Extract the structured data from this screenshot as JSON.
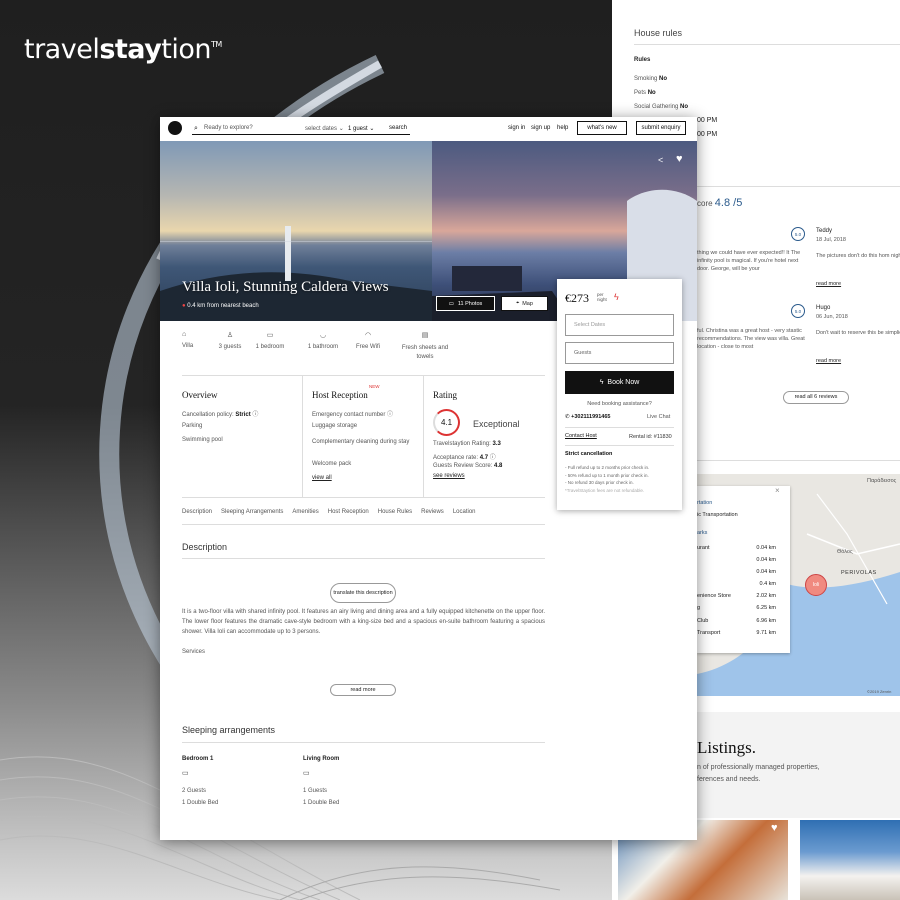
{
  "brand": {
    "prefix": "travel",
    "bold": "stay",
    "suffix": "tion",
    "tm": "TM"
  },
  "nav": {
    "search_placeholder": "Ready to explore?",
    "select_dates": "select dates",
    "guests": "1 guest",
    "search": "search",
    "sign_in": "sign in",
    "sign_up": "sign up",
    "help": "help",
    "whats_new": "what's new",
    "submit_enquiry": "submit enquiry"
  },
  "hero": {
    "title": "Villa Ioli, Stunning Caldera Views",
    "distance": "0.4 km from nearest beach",
    "photos_btn": "11 Photos",
    "map_btn": "Map"
  },
  "amenities": [
    {
      "icon": "house-icon",
      "label": "Villa"
    },
    {
      "icon": "guests-icon",
      "label": "3 guests"
    },
    {
      "icon": "bed-icon",
      "label": "1 bedroom"
    },
    {
      "icon": "bath-icon",
      "label": "1 bathroom"
    },
    {
      "icon": "wifi-icon",
      "label": "Free Wifi"
    },
    {
      "icon": "towels-icon",
      "label": "Fresh sheets and towels"
    }
  ],
  "overview": {
    "title": "Overview",
    "cancel_label": "Cancellation policy:",
    "cancel_value": "Strict",
    "items": [
      "Parking",
      "Swimming pool"
    ]
  },
  "reception": {
    "title": "Host Reception",
    "badge": "NEW",
    "items": [
      "Emergency contact number",
      "Luggage storage",
      "Complementary cleaning during stay",
      "Welcome pack"
    ],
    "view_all": "view all"
  },
  "rating": {
    "title": "Rating",
    "score": "4.1",
    "label": "Exceptional",
    "rows": [
      {
        "k": "Travelstaytion Rating:",
        "v": "3.3"
      },
      {
        "k": "Acceptance rate:",
        "v": "4.7"
      },
      {
        "k": "Guests Review Score:",
        "v": "4.8"
      }
    ],
    "see_reviews": "see reviews"
  },
  "tabs": [
    "Description",
    "Sleeping Arrangements",
    "Amenities",
    "Host Reception",
    "House Rules",
    "Reviews",
    "Location"
  ],
  "description": {
    "title": "Description",
    "translate": "translate this description",
    "text": "It is a two-floor villa with shared infinity pool. It features an airy living and dining area and a fully equipped kitchenette on the upper floor. The lower floor features the dramatic cave-style bedroom with a king-size bed and a spacious en-suite bathroom featuring a spacious shower. Villa Ioli can accommodate up to 3 persons.",
    "services": "Services",
    "read_more": "read more"
  },
  "sleeping": {
    "title": "Sleeping arrangements",
    "rooms": [
      {
        "name": "Bedroom 1",
        "guests": "2 Guests",
        "bed": "1 Double Bed"
      },
      {
        "name": "Living Room",
        "guests": "1 Guests",
        "bed": "1 Double Bed"
      }
    ]
  },
  "booking": {
    "price": "€273",
    "per": "per",
    "night": "night",
    "dates_placeholder": "Select Dates",
    "guests_placeholder": "Guests",
    "book_now": "Book Now",
    "need_help": "Need booking assistance?",
    "phone": "+302111991465",
    "live_chat": "Live Chat",
    "contact_host": "Contact Host",
    "rental_id": "Rental id: #11830",
    "cancel_title": "Strict cancellation",
    "cancel_lines": [
      "- Full refund up to 2 months prior check in.",
      "- 50% refund up to 1 month prior check in.",
      "- No refund 30 days prior check in.",
      "*TravelStaytion fees are not refundable."
    ]
  },
  "house_rules": {
    "title": "House rules",
    "sub": "Rules",
    "rows": [
      {
        "k": "Smoking",
        "v": "No"
      },
      {
        "k": "Pets",
        "v": "No"
      },
      {
        "k": "Social Gathering",
        "v": "No"
      }
    ],
    "times": [
      "00 PM",
      "00 PM"
    ]
  },
  "reviews": {
    "score_label": "core",
    "score": "4.8 /5",
    "items": [
      {
        "avatar": "5.0",
        "name": "Teddy",
        "date": "18 Jul, 2018",
        "left_text": "thing we could have ever expected!! It The infinity pool is magical. If you're hotel next door. George, will be your",
        "text": "The pictures don't do this hom night from the patio. The insid The distance is just far enough",
        "read_more": "read more"
      },
      {
        "avatar": "5.0",
        "name": "Hugo",
        "date": "06 Jun, 2018",
        "left_text": "ful. Christina was a great host - very stastic recommendations. The view was villa. Great location - close to most",
        "text": "Don't wait to reserve this be simplicity is perfection and it's vacation and I'm still pinching m",
        "read_more": "read more"
      }
    ],
    "read_all": "read all 6 reviews"
  },
  "map": {
    "head1": "rtation",
    "head2": "ic Transportation",
    "head3": "arks",
    "rows": [
      {
        "k": "urant",
        "v": "0.04 km"
      },
      {
        "k": "",
        "v": "0.04 km"
      },
      {
        "k": "",
        "v": "0.04 km"
      },
      {
        "k": "",
        "v": "0.4 km"
      },
      {
        "k": "enience Store",
        "v": "2.02 km"
      },
      {
        "k": "g",
        "v": "6.25 km"
      },
      {
        "k": "Club",
        "v": "6.96 km"
      },
      {
        "k": "Transport",
        "v": "9.71 km"
      }
    ],
    "marker": "Ioli",
    "place1": "Παράδεισος",
    "place2": "Θόλος",
    "place3": "PERIVOLAS",
    "copyright": "©2019 Zenrin"
  },
  "listings": {
    "title": "Listings.",
    "line1": "n of professionally managed properties,",
    "line2": "ferences and needs."
  }
}
